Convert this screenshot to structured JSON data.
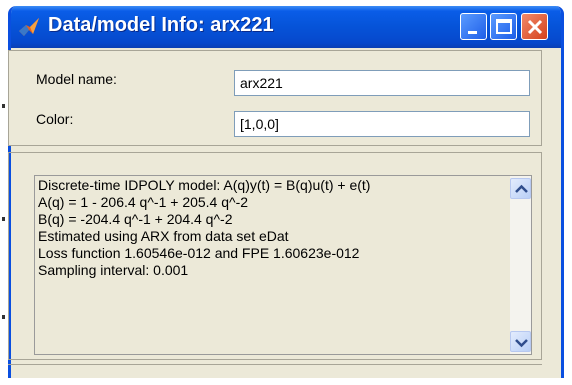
{
  "window": {
    "title": "Data/model Info: arx221",
    "icons": {
      "app": "matlab-icon",
      "minimize": "minimize-icon",
      "maximize": "maximize-icon",
      "close": "close-icon"
    },
    "colors": {
      "titlebar": "#0653d8",
      "close_button": "#d5411c",
      "body": "#ece9d8"
    }
  },
  "fields": {
    "model_name_label": "Model name:",
    "model_name_value": "arx221",
    "color_label": "Color:",
    "color_value": "[1,0,0]"
  },
  "info": {
    "lines": [
      "Discrete-time IDPOLY model: A(q)y(t) = B(q)u(t) + e(t)",
      "A(q) = 1 - 206.4 q^-1 + 205.4 q^-2",
      "B(q) = -204.4 q^-1 + 204.4 q^-2",
      "Estimated using ARX from data set eDat",
      "Loss function 1.60546e-012 and FPE 1.60623e-012",
      "Sampling interval: 0.001"
    ],
    "scroll_icons": {
      "up": "scroll-up-arrow-icon",
      "down": "scroll-down-arrow-icon"
    }
  }
}
